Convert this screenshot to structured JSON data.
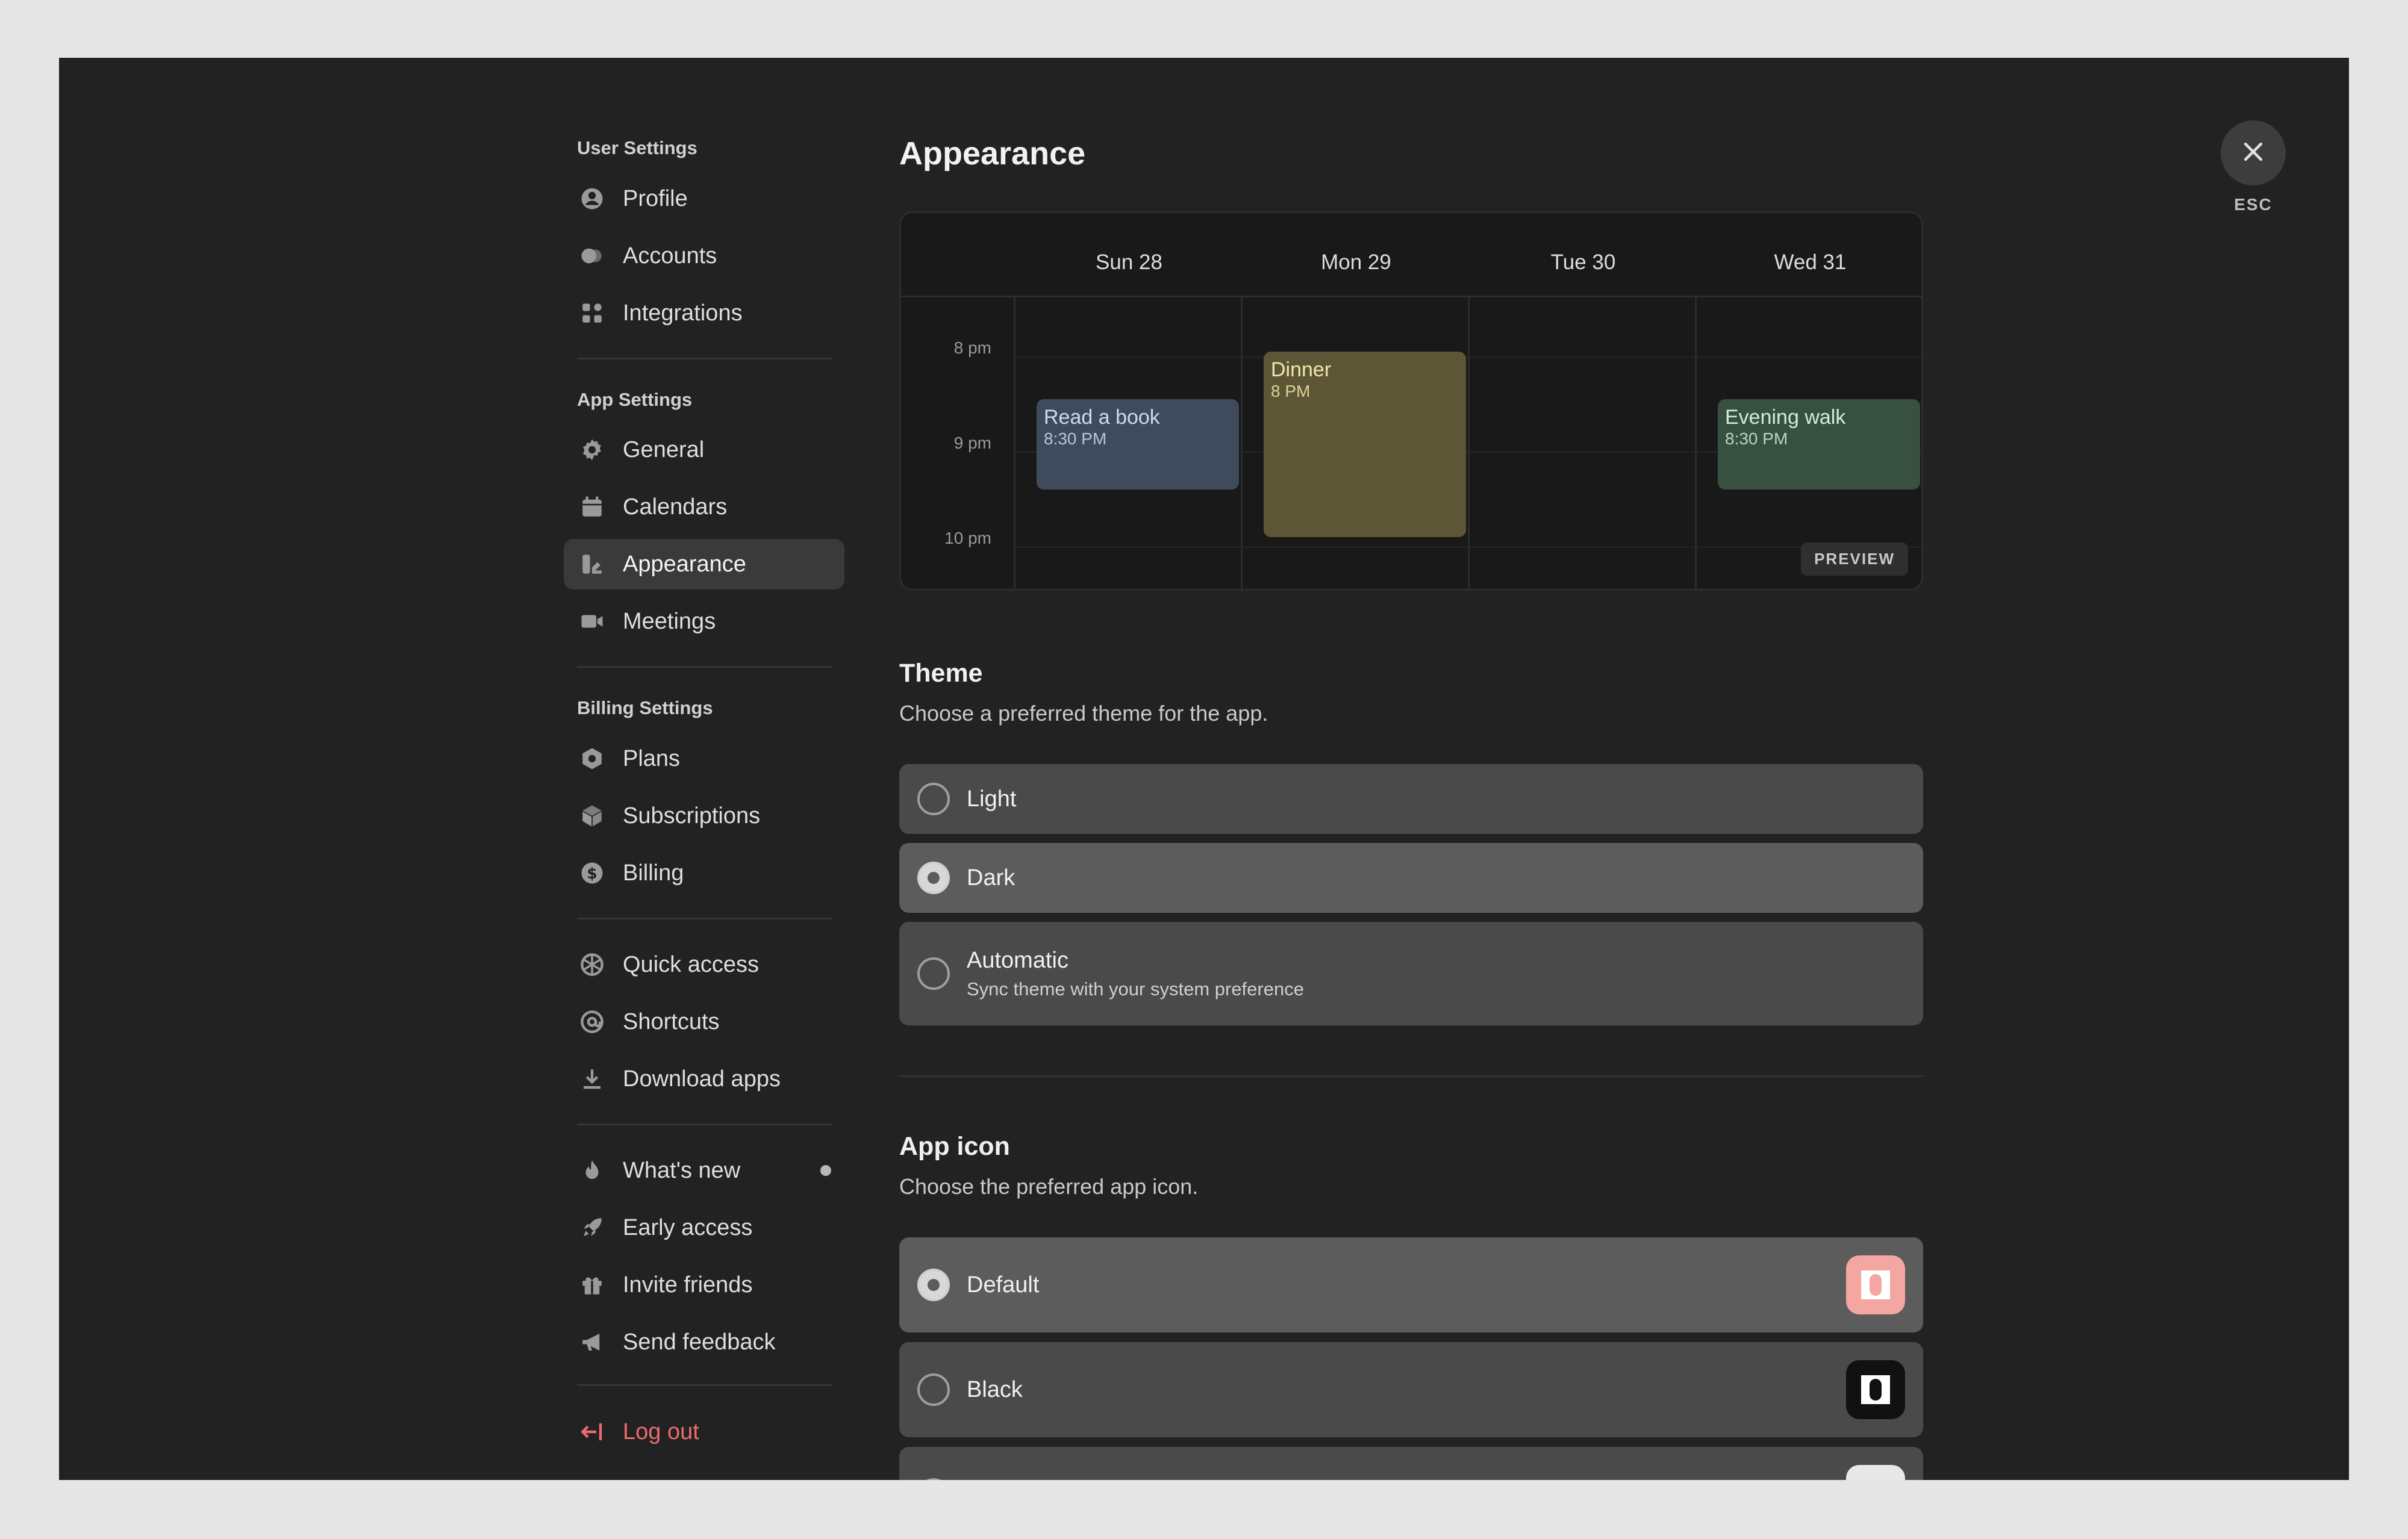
{
  "sidebar": {
    "sections": [
      {
        "title": "User Settings",
        "items": [
          {
            "label": "Profile",
            "icon": "user-circle-icon"
          },
          {
            "label": "Accounts",
            "icon": "toggle-icon"
          },
          {
            "label": "Integrations",
            "icon": "grid-icon"
          }
        ]
      },
      {
        "title": "App Settings",
        "items": [
          {
            "label": "General",
            "icon": "gear-icon"
          },
          {
            "label": "Calendars",
            "icon": "calendar-icon"
          },
          {
            "label": "Appearance",
            "icon": "brush-icon",
            "active": true
          },
          {
            "label": "Meetings",
            "icon": "video-icon"
          }
        ]
      },
      {
        "title": "Billing Settings",
        "items": [
          {
            "label": "Plans",
            "icon": "hexagon-icon"
          },
          {
            "label": "Subscriptions",
            "icon": "box-icon"
          },
          {
            "label": "Billing",
            "icon": "dollar-icon"
          }
        ]
      },
      {
        "title": "",
        "items": [
          {
            "label": "Quick access",
            "icon": "aperture-icon"
          },
          {
            "label": "Shortcuts",
            "icon": "at-icon"
          },
          {
            "label": "Download apps",
            "icon": "download-icon"
          }
        ]
      },
      {
        "title": "",
        "items": [
          {
            "label": "What's new",
            "icon": "flame-icon",
            "badge": true
          },
          {
            "label": "Early access",
            "icon": "rocket-icon"
          },
          {
            "label": "Invite friends",
            "icon": "gift-icon"
          },
          {
            "label": "Send feedback",
            "icon": "megaphone-icon"
          }
        ]
      }
    ],
    "logout": {
      "label": "Log out",
      "icon": "logout-icon"
    }
  },
  "main": {
    "title": "Appearance",
    "calendar": {
      "days": [
        "Sun 28",
        "Mon 29",
        "Tue 30",
        "Wed 31"
      ],
      "times": [
        "8 pm",
        "9 pm",
        "10 pm"
      ],
      "events": [
        {
          "title": "Read a book",
          "time": "8:30 PM",
          "color": "#3f4b5c",
          "text": "#c9daf5"
        },
        {
          "title": "Dinner",
          "time": "8 PM",
          "color": "#5c5636",
          "text": "#f3e6a8"
        },
        {
          "title": "Evening walk",
          "time": "8:30 PM",
          "color": "#38503f",
          "text": "#cdeed6"
        }
      ],
      "preview_label": "PREVIEW"
    },
    "theme": {
      "heading": "Theme",
      "subtitle": "Choose a preferred theme for the app.",
      "options": [
        {
          "label": "Light",
          "selected": false
        },
        {
          "label": "Dark",
          "selected": true
        },
        {
          "label": "Automatic",
          "desc": "Sync theme with your system preference",
          "selected": false
        }
      ]
    },
    "app_icon": {
      "heading": "App icon",
      "subtitle": "Choose the preferred app icon.",
      "options": [
        {
          "label": "Default",
          "selected": true,
          "icon_bg": "#f4a6a0"
        },
        {
          "label": "Black",
          "selected": false,
          "icon_bg": "#111111"
        }
      ]
    }
  },
  "close": {
    "label": "ESC"
  }
}
